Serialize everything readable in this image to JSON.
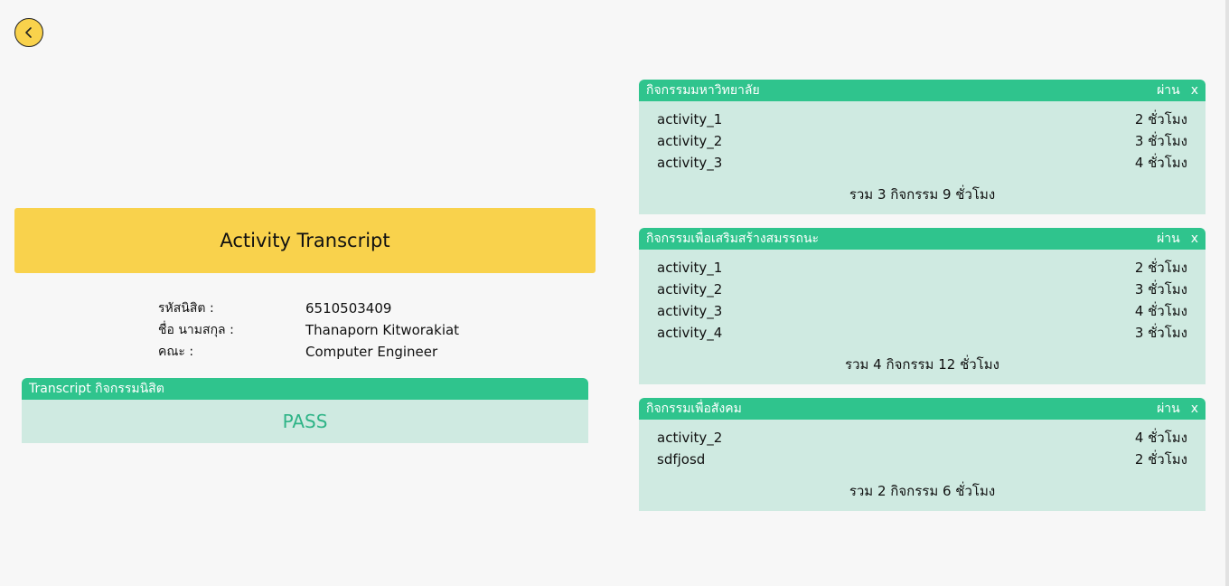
{
  "title": "Activity Transcript",
  "student": {
    "id_label": "รหัสนิสิต :",
    "id_value": "6510503409",
    "name_label": "ชื่อ นามสกุล :",
    "name_value": "Thanaporn Kitworakiat",
    "faculty_label": "คณะ :",
    "faculty_value": "Computer Engineer"
  },
  "transcript": {
    "header": "Transcript กิจกรรมนิสิต",
    "result": "PASS"
  },
  "categories": [
    {
      "title": "กิจกรรมมหาวิทยาลัย",
      "status": "ผ่าน",
      "close": "x",
      "activities": [
        {
          "name": "activity_1",
          "hours": "2 ชั่วโมง"
        },
        {
          "name": "activity_2",
          "hours": "3 ชั่วโมง"
        },
        {
          "name": "activity_3",
          "hours": "4 ชั่วโมง"
        }
      ],
      "summary": "รวม 3 กิจกรรม 9 ชั่วโมง"
    },
    {
      "title": "กิจกรรมเพื่อเสริมสร้างสมรรถนะ",
      "status": "ผ่าน",
      "close": "x",
      "activities": [
        {
          "name": "activity_1",
          "hours": "2 ชั่วโมง"
        },
        {
          "name": "activity_2",
          "hours": "3 ชั่วโมง"
        },
        {
          "name": "activity_3",
          "hours": "4 ชั่วโมง"
        },
        {
          "name": "activity_4",
          "hours": "3 ชั่วโมง"
        }
      ],
      "summary": "รวม 4 กิจกรรม 12 ชั่วโมง"
    },
    {
      "title": "กิจกรรมเพื่อสังคม",
      "status": "ผ่าน",
      "close": "x",
      "activities": [
        {
          "name": "activity_2",
          "hours": "4 ชั่วโมง"
        },
        {
          "name": "sdfjosd",
          "hours": "2 ชั่วโมง"
        }
      ],
      "summary": "รวม 2 กิจกรรม 6 ชั่วโมง"
    }
  ],
  "colors": {
    "accent_yellow": "#f9d24c",
    "accent_green": "#2fc48d",
    "panel_bg": "#cfeae1",
    "pass_text": "#2fb487"
  },
  "icons": {
    "back": "chevron-left-icon"
  }
}
